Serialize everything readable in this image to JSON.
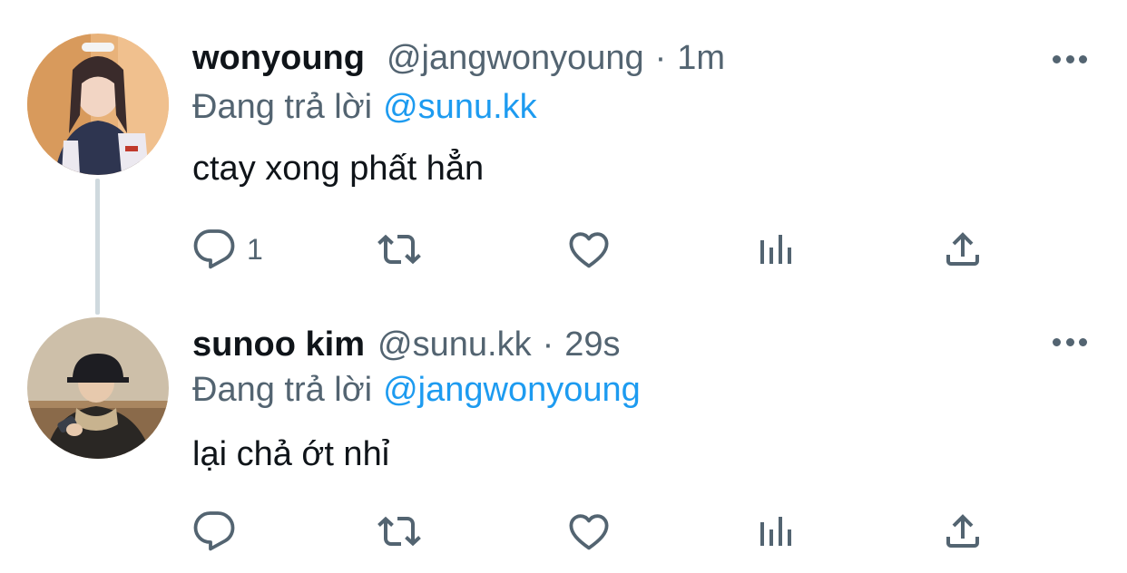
{
  "tweets": [
    {
      "display_name": "wonyoung",
      "handle": "@jangwonyoung",
      "separator": "·",
      "time": "1m",
      "reply_prefix": "Đang trả lời",
      "reply_to": "@sunu.kk",
      "text": "ctay xong phất hẳn",
      "reply_count": "1",
      "icons": [
        "reply-icon",
        "retweet-icon",
        "like-icon",
        "views-icon",
        "share-icon",
        "more-icon"
      ]
    },
    {
      "display_name": "sunoo kim",
      "handle": "@sunu.kk",
      "separator": "·",
      "time": "29s",
      "reply_prefix": "Đang trả lời",
      "reply_to": "@jangwonyoung",
      "text": "lại chả ớt nhỉ",
      "reply_count": "",
      "icons": [
        "reply-icon",
        "retweet-icon",
        "like-icon",
        "views-icon",
        "share-icon",
        "more-icon"
      ]
    }
  ],
  "colors": {
    "text_primary": "#0f1419",
    "text_secondary": "#536471",
    "link": "#1d9bf0",
    "thread_line": "#cfd9de"
  }
}
